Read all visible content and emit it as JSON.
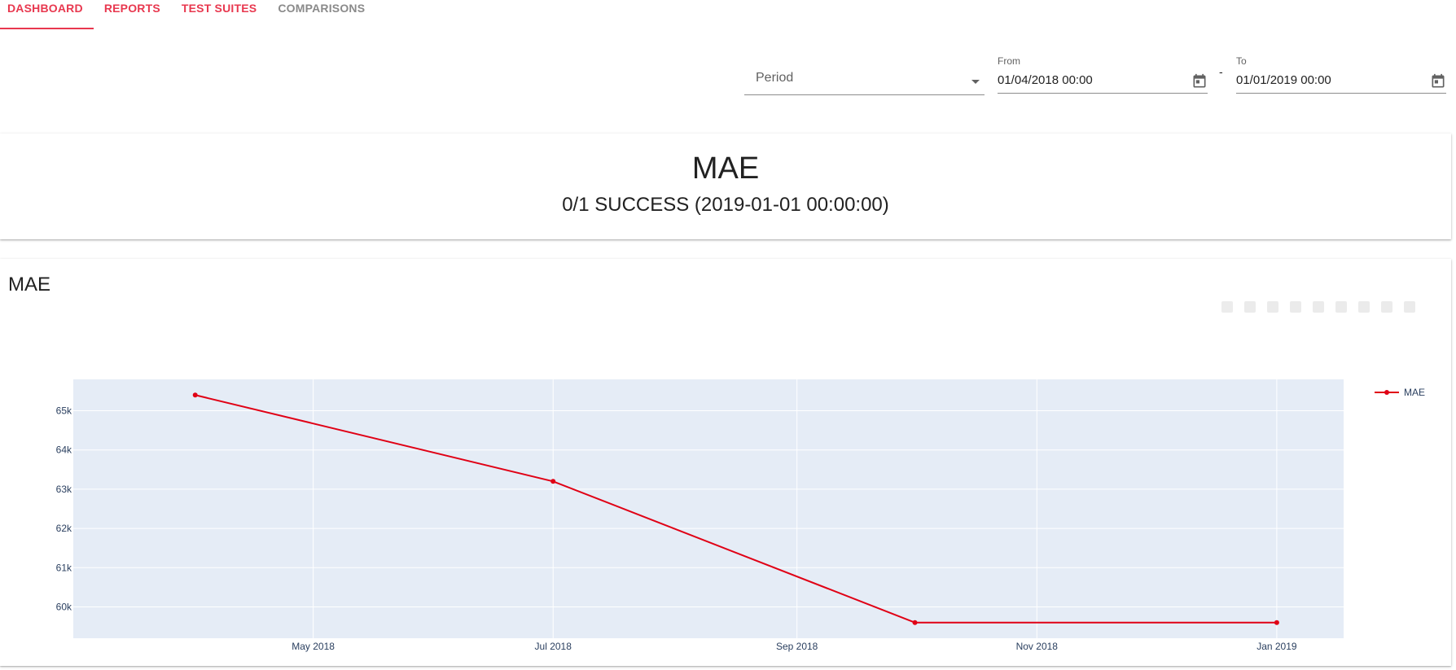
{
  "tabs": [
    {
      "label": "DASHBOARD",
      "active": true
    },
    {
      "label": "REPORTS",
      "active": false
    },
    {
      "label": "TEST SUITES",
      "active": false
    },
    {
      "label": "COMPARISONS",
      "active": false
    }
  ],
  "filters": {
    "period": {
      "label": "Period"
    },
    "from": {
      "label": "From",
      "value": "01/04/2018 00:00"
    },
    "separator": "-",
    "to": {
      "label": "To",
      "value": "01/01/2019 00:00"
    }
  },
  "summary": {
    "title": "MAE",
    "status": "0/1 SUCCESS (2019-01-01 00:00:00)"
  },
  "chart_card": {
    "title": "MAE"
  },
  "colors": {
    "accent": "#e8384f",
    "line": "#e00015",
    "plot_bg": "#e5ecf6",
    "grid": "#ffffff",
    "tick_text": "#2a3f5f"
  },
  "chart_data": {
    "type": "line",
    "title": "MAE",
    "xlabel": "",
    "ylabel": "",
    "series": [
      {
        "name": "MAE",
        "x": [
          "2018-04-01",
          "2018-07-01",
          "2018-10-01",
          "2019-01-01"
        ],
        "y": [
          65400,
          63200,
          59600,
          59600
        ]
      }
    ],
    "xlim": [
      "2018-03-01",
      "2019-01-18"
    ],
    "ylim": [
      59200,
      65800
    ],
    "x_ticks": [
      {
        "date": "2018-05-01",
        "label": "May 2018"
      },
      {
        "date": "2018-07-01",
        "label": "Jul 2018"
      },
      {
        "date": "2018-09-01",
        "label": "Sep 2018"
      },
      {
        "date": "2018-11-01",
        "label": "Nov 2018"
      },
      {
        "date": "2019-01-01",
        "label": "Jan 2019"
      }
    ],
    "y_ticks": [
      {
        "value": 60000,
        "label": "60k"
      },
      {
        "value": 61000,
        "label": "61k"
      },
      {
        "value": 62000,
        "label": "62k"
      },
      {
        "value": 63000,
        "label": "63k"
      },
      {
        "value": 64000,
        "label": "64k"
      },
      {
        "value": 65000,
        "label": "65k"
      }
    ],
    "grid": true,
    "legend": "right"
  }
}
